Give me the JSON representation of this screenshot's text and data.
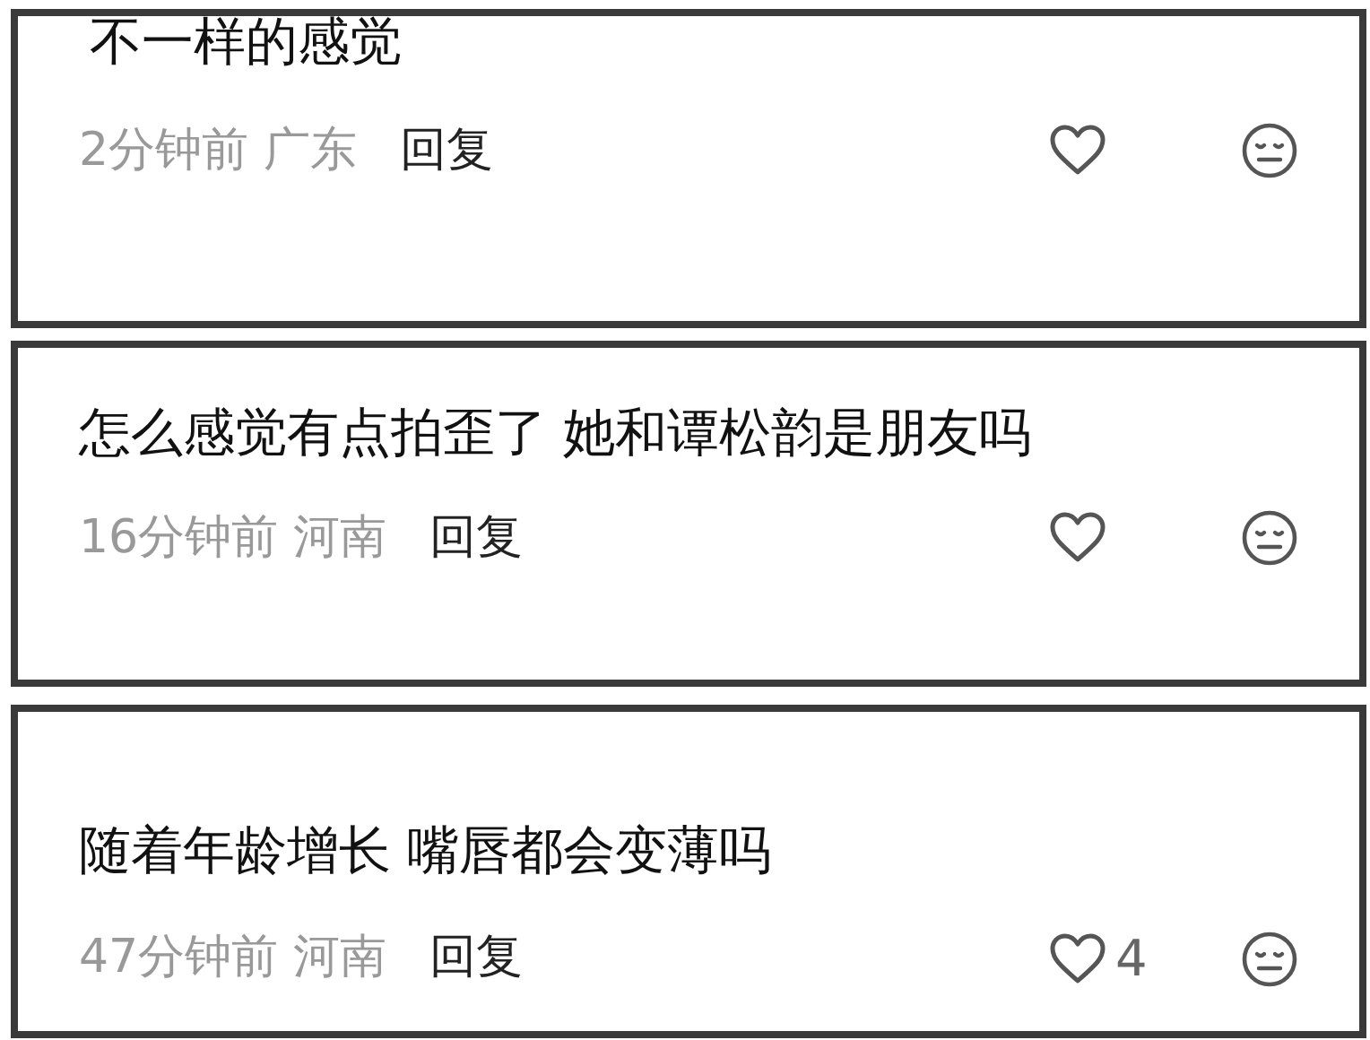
{
  "comments": [
    {
      "text": "不一样的感觉",
      "time": "2分钟前",
      "location": "广东",
      "reply": "回复"
    },
    {
      "text": "怎么感觉有点拍歪了 她和谭松韵是朋友吗",
      "time": "16分钟前",
      "location": "河南",
      "reply": "回复"
    },
    {
      "text": "随着年龄增长 嘴唇都会变薄吗",
      "time": "47分钟前",
      "location": "河南",
      "reply": "回复",
      "likes": "4"
    }
  ]
}
